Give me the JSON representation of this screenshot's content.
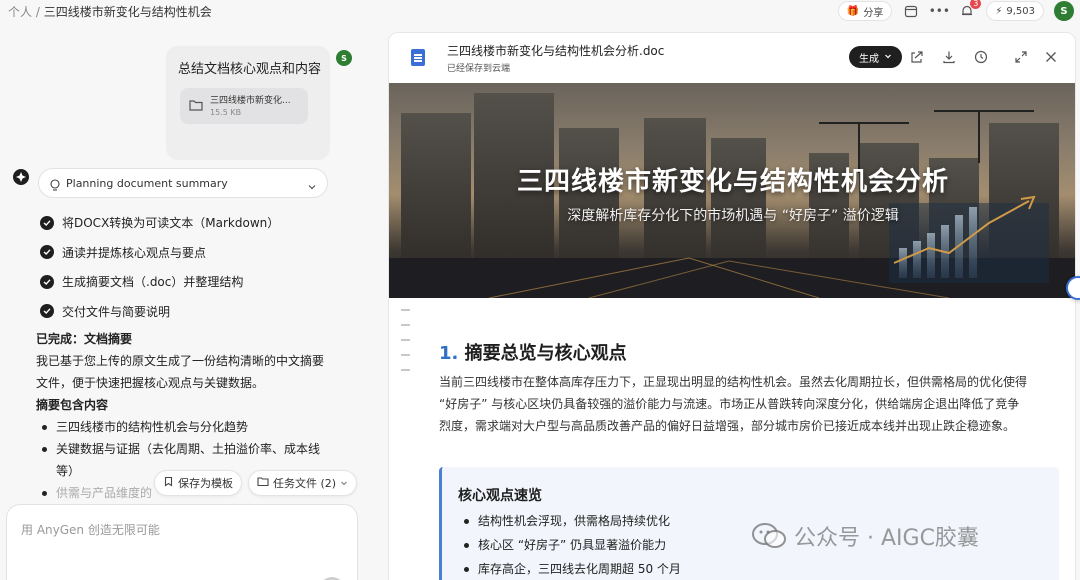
{
  "breadcrumb": {
    "root": "个人",
    "separator": "/",
    "current": "三四线楼市新变化与结构性机会"
  },
  "top_actions": {
    "share_label": "分享",
    "notification_count": "3",
    "credits": "9,503",
    "user_initial": "S"
  },
  "chat": {
    "user_message": "总结文档核心观点和内容",
    "attachment": {
      "name": "三四线楼市新变化...",
      "size": "15.5 KB"
    },
    "planning_label": "Planning document summary",
    "steps": [
      "将DOCX转换为可读文本（Markdown）",
      "通读并提炼核心观点与要点",
      "生成摘要文档（.doc）并整理结构",
      "交付文件与简要说明"
    ],
    "done_title": "已完成：文档摘要",
    "done_text": "我已基于您上传的原文生成了一份结构清晰的中文摘要文件，便于快速把握核心观点与关键数据。",
    "contents_title": "摘要包含内容",
    "contents": [
      "三四线楼市的结构性机会与分化趋势",
      "关键数据与证据（去化周期、土拍溢价率、成本线等）",
      "供需与产品维度的"
    ],
    "save_template_label": "保存为模板",
    "task_files_label": "任务文件 (2)",
    "input_placeholder": "用 AnyGen 创造无限可能"
  },
  "document": {
    "file_name": "三四线楼市新变化与结构性机会分析.doc",
    "save_status": "已经保存到云端",
    "generate_label": "生成",
    "banner_title": "三四线楼市新变化与结构性机会分析",
    "banner_subtitle": "深度解析库存分化下的市场机遇与 “好房子” 溢价逻辑",
    "section_number": "1.",
    "section_title": "摘要总览与核心观点",
    "section_body": "当前三四线楼市在整体高库存压力下，正显现出明显的结构性机会。虽然去化周期拉长，但供需格局的优化使得 “好房子” 与核心区块仍具备较强的溢价能力与流速。市场正从普跌转向深度分化，供给端房企退出降低了竞争烈度，需求端对大户型与高品质改善产品的偏好日益增强，部分城市房价已接近成本线并出现止跌企稳迹象。",
    "callout_title": "核心观点速览",
    "callout_items": [
      "结构性机会浮现，供需格局持续优化",
      "核心区 “好房子” 仍具显著溢价能力",
      "库存高企，三四线去化周期超 50 个月"
    ]
  },
  "watermark": "公众号 · AIGC胶囊",
  "colors": {
    "accent": "#2f6fc4",
    "avatar": "#2f7d32",
    "generate_button": "#1f1f1f",
    "callout_bg": "#f2f6fc"
  }
}
